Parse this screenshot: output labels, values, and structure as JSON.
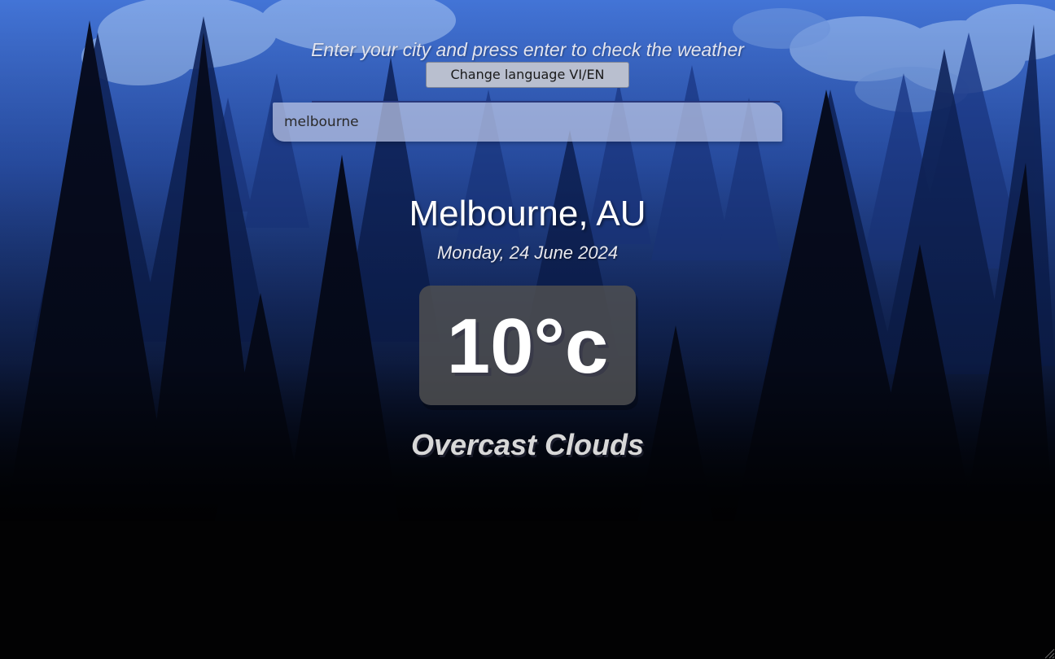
{
  "header": {
    "prompt": "Enter your city and press enter to check the weather",
    "language_button": "Change language VI/EN"
  },
  "search": {
    "value": "melbourne"
  },
  "weather": {
    "location": "Melbourne, AU",
    "date": "Monday, 24 June 2024",
    "temperature": "10°c",
    "condition": "Overcast Clouds"
  },
  "colors": {
    "sky_top": "#3b63c4",
    "sky_mid": "#1d3a8a",
    "ground": "#030407",
    "card": "#505050"
  },
  "icons": [
    "resize-grip-icon"
  ]
}
